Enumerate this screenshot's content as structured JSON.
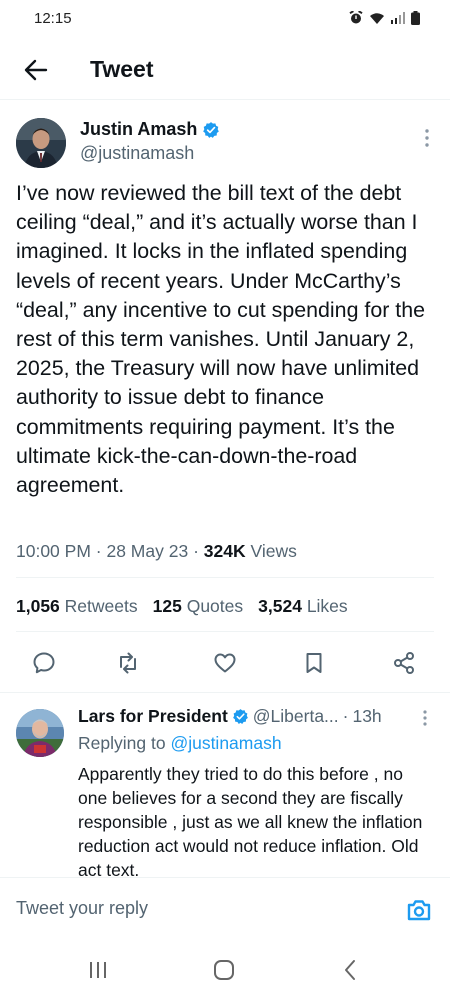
{
  "status_bar": {
    "time": "12:15"
  },
  "header": {
    "title": "Tweet"
  },
  "tweet": {
    "author_name": "Justin Amash",
    "author_handle": "@justinamash",
    "text": "I’ve now reviewed the bill text of the debt ceiling “deal,” and it’s actually worse than I imagined. It locks in the inflated spending levels of recent years. Under McCarthy’s “deal,” any incentive to cut spending for the rest of this term vanishes. Until January 2, 2025, the Treasury will now have unlimited authority to issue debt to finance commitments requiring payment. It’s the ultimate kick-the-can-down-the-road agreement.",
    "time": "10:00 PM",
    "date": "28 May 23",
    "separator": "·",
    "views_count": "324K",
    "views_label": "Views",
    "retweets_count": "1,056",
    "retweets_label": "Retweets",
    "quotes_count": "125",
    "quotes_label": "Quotes",
    "likes_count": "3,524",
    "likes_label": "Likes"
  },
  "reply": {
    "author_name": "Lars for President",
    "author_handle": "@Liberta...",
    "separator": "·",
    "time": "13h",
    "replying_prefix": "Replying to",
    "replying_handle": "@justinamash",
    "text": "Apparently they tried to do this before , no one believes for a second they are fiscally responsible , just as we all knew the inflation reduction act would not reduce inflation. Old act text."
  },
  "compose": {
    "placeholder": "Tweet your reply"
  },
  "icons": {
    "verified": "verified-badge-icon",
    "back": "arrow-left-icon",
    "more": "more-vertical-icon",
    "reply": "reply-bubble-icon",
    "retweet": "retweet-icon",
    "like": "heart-icon",
    "bookmark": "bookmark-icon",
    "share": "share-icon",
    "camera": "camera-icon"
  },
  "colors": {
    "accent": "#1d9bf0",
    "text": "#0f1419",
    "secondary": "#536471",
    "divider": "#eff3f4"
  }
}
